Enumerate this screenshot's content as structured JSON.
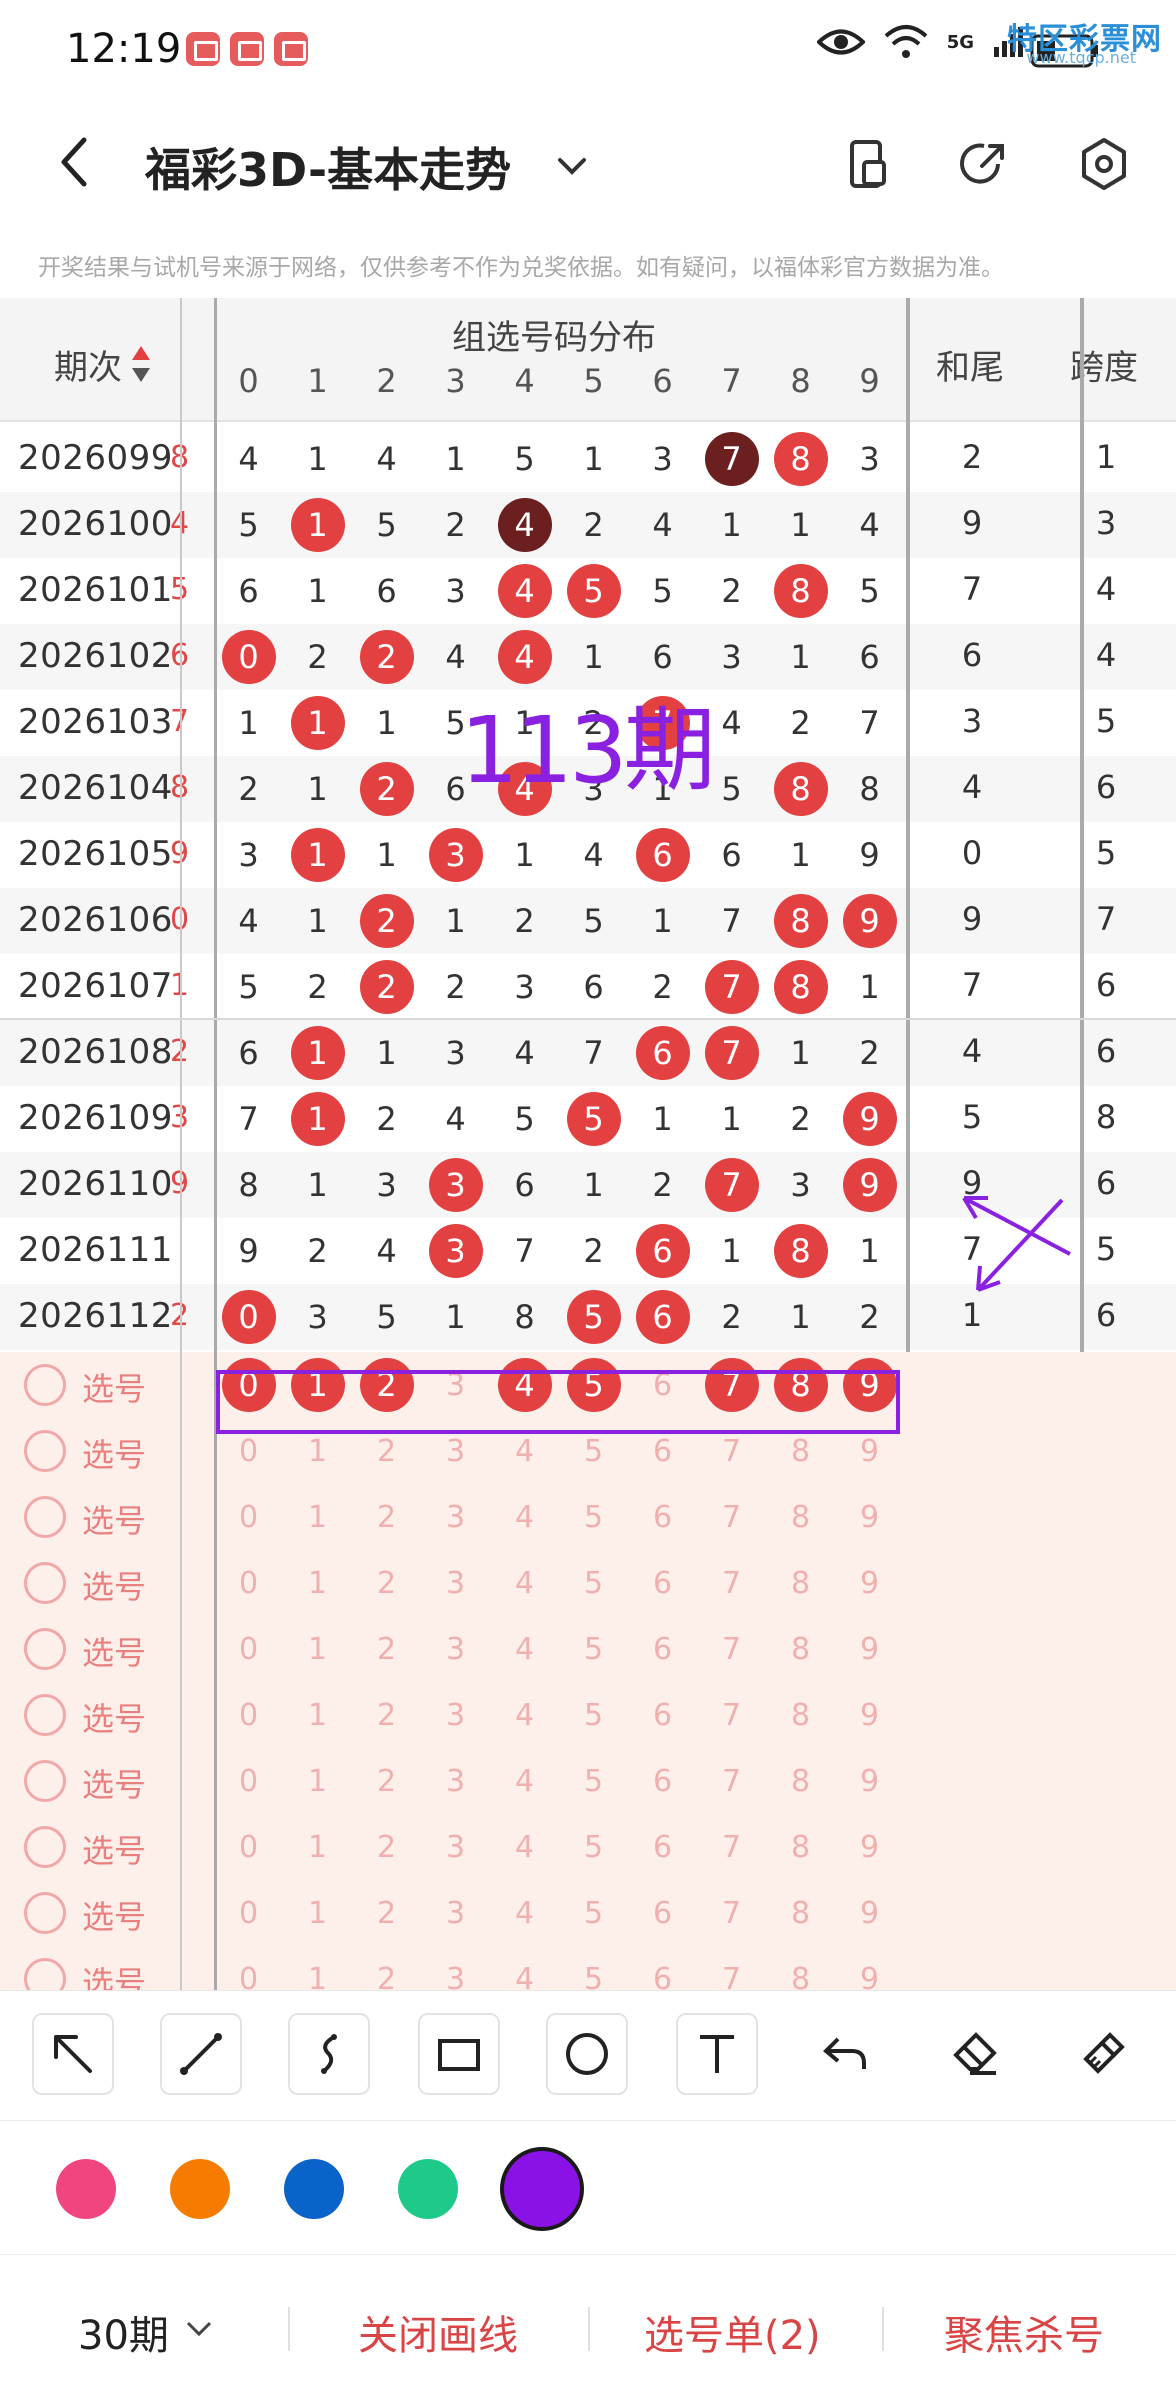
{
  "status": {
    "time": "12:19",
    "network": "5G",
    "battery": ""
  },
  "watermark": {
    "title": "特区彩票网",
    "sub": "www.tqcp.net"
  },
  "header": {
    "title": "福彩3D-基本走势"
  },
  "disclaimer": "开奖结果与试机号来源于网络，仅供参考不作为兑奖依据。如有疑问，以福体彩官方数据为准。",
  "table": {
    "col_period": "期次",
    "col_group": "组选号码分布",
    "col_sum_tail": "和尾",
    "col_span": "跨度",
    "digits": [
      "0",
      "1",
      "2",
      "3",
      "4",
      "5",
      "6",
      "7",
      "8",
      "9"
    ],
    "cut_digits": [
      "8",
      "4",
      "5",
      "6",
      "7",
      "8",
      "9",
      "0",
      "1",
      "2",
      "3",
      "9",
      "",
      "2"
    ],
    "rows": [
      {
        "period": "2026099",
        "cells": [
          "4",
          "1",
          "4",
          "1",
          "5",
          "1",
          "3",
          "7",
          "8",
          "3"
        ],
        "sum_tail": "2",
        "span": "1"
      },
      {
        "period": "2026100",
        "cells": [
          "5",
          "1",
          "5",
          "2",
          "4",
          "2",
          "4",
          "1",
          "1",
          "4"
        ],
        "sum_tail": "9",
        "span": "3"
      },
      {
        "period": "2026101",
        "cells": [
          "6",
          "1",
          "6",
          "3",
          "4",
          "5",
          "5",
          "2",
          "8",
          "5"
        ],
        "sum_tail": "7",
        "span": "4"
      },
      {
        "period": "2026102",
        "cells": [
          "0",
          "2",
          "2",
          "4",
          "4",
          "1",
          "6",
          "3",
          "1",
          "6"
        ],
        "sum_tail": "6",
        "span": "4"
      },
      {
        "period": "2026103",
        "cells": [
          "1",
          "1",
          "1",
          "5",
          "1",
          "2",
          "7",
          "4",
          "2",
          "7"
        ],
        "sum_tail": "3",
        "span": "5"
      },
      {
        "period": "2026104",
        "cells": [
          "2",
          "1",
          "2",
          "6",
          "4",
          "3",
          "1",
          "5",
          "8",
          "8"
        ],
        "sum_tail": "4",
        "span": "6"
      },
      {
        "period": "2026105",
        "cells": [
          "3",
          "1",
          "1",
          "3",
          "1",
          "4",
          "6",
          "6",
          "1",
          "9"
        ],
        "sum_tail": "0",
        "span": "5"
      },
      {
        "period": "2026106",
        "cells": [
          "4",
          "1",
          "2",
          "1",
          "2",
          "5",
          "1",
          "7",
          "8",
          "9"
        ],
        "sum_tail": "9",
        "span": "7"
      },
      {
        "period": "2026107",
        "cells": [
          "5",
          "2",
          "2",
          "2",
          "3",
          "6",
          "2",
          "7",
          "8",
          "1"
        ],
        "sum_tail": "7",
        "span": "6"
      },
      {
        "period": "2026108",
        "cells": [
          "6",
          "1",
          "1",
          "3",
          "4",
          "7",
          "6",
          "7",
          "1",
          "2"
        ],
        "sum_tail": "4",
        "span": "6"
      },
      {
        "period": "2026109",
        "cells": [
          "7",
          "1",
          "2",
          "4",
          "5",
          "5",
          "1",
          "1",
          "2",
          "9"
        ],
        "sum_tail": "5",
        "span": "8"
      },
      {
        "period": "2026110",
        "cells": [
          "8",
          "1",
          "3",
          "3",
          "6",
          "1",
          "2",
          "7",
          "3",
          "9"
        ],
        "sum_tail": "9",
        "span": "6"
      },
      {
        "period": "2026111",
        "cells": [
          "9",
          "2",
          "4",
          "3",
          "7",
          "2",
          "6",
          "1",
          "8",
          "1"
        ],
        "sum_tail": "7",
        "span": "5"
      },
      {
        "period": "2026112",
        "cells": [
          "0",
          "3",
          "5",
          "1",
          "8",
          "5",
          "6",
          "2",
          "1",
          "2"
        ],
        "sum_tail": "1",
        "span": "6"
      }
    ],
    "select_label": "选号",
    "select_rows": 10
  },
  "annotation": {
    "text": "113期"
  },
  "draw_tools": [
    "arrow",
    "line",
    "curve",
    "rectangle",
    "circle",
    "text",
    "undo",
    "eraser",
    "clear"
  ],
  "colors": [
    "#f0457e",
    "#f57c00",
    "#0a63c8",
    "#1ec98a",
    "#8b12e6"
  ],
  "selected_color": "#8b12e6",
  "bottom": {
    "periods": "30期",
    "close_draw": "关闭画线",
    "pick_list": "选号单(2)",
    "focus_kill": "聚焦杀号"
  }
}
